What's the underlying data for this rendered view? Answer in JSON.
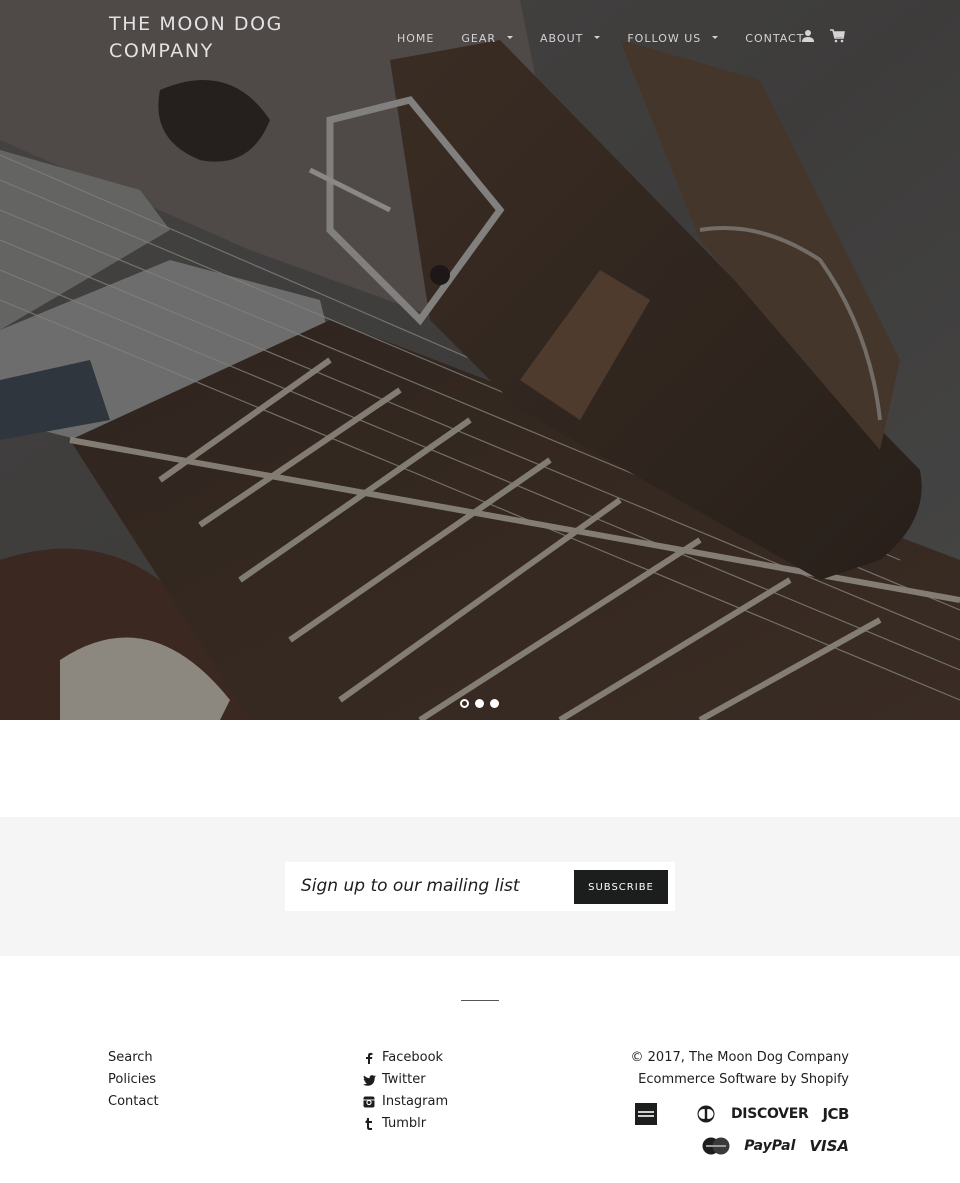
{
  "header": {
    "logo": "THE MOON DOG COMPANY",
    "nav": [
      {
        "label": "HOME",
        "dropdown": false
      },
      {
        "label": "GEAR",
        "dropdown": true
      },
      {
        "label": "ABOUT",
        "dropdown": true
      },
      {
        "label": "FOLLOW US",
        "dropdown": true
      },
      {
        "label": "CONTACT",
        "dropdown": false
      }
    ],
    "icons": [
      "account-icon",
      "cart-icon"
    ]
  },
  "hero": {
    "slides": 3,
    "active_slide": 1,
    "image_alt": "Leather belt on electric guitar fretboard"
  },
  "newsletter": {
    "placeholder": "Sign up to our mailing list",
    "value": "",
    "button_label": "SUBSCRIBE"
  },
  "footer": {
    "links": [
      "Search",
      "Policies",
      "Contact"
    ],
    "social": [
      {
        "label": "Facebook",
        "icon": "facebook-icon"
      },
      {
        "label": "Twitter",
        "icon": "twitter-icon"
      },
      {
        "label": "Instagram",
        "icon": "instagram-icon"
      },
      {
        "label": "Tumblr",
        "icon": "tumblr-icon"
      }
    ],
    "copyright_prefix": "© 2017, ",
    "company_link": "The Moon Dog Company",
    "powered_by": "Ecommerce Software by Shopify",
    "payments": [
      "American Express",
      "Diners Club",
      "DISCOVER",
      "JCB",
      "MasterCard",
      "PayPal",
      "VISA"
    ]
  },
  "colors": {
    "dark": "#1c1d1d",
    "newsletter_bg": "#f5f5f5",
    "nav_text": "#d4d4d4"
  }
}
